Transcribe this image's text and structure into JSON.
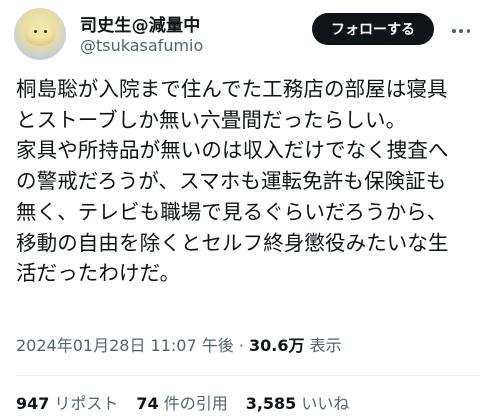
{
  "author": {
    "display_name": "司史生@減量中",
    "handle": "@tsukasafumio",
    "avatar_icon": "yellow-blob-avatar"
  },
  "follow_button": {
    "label": "フォローする"
  },
  "tweet": {
    "lines": [
      "桐島聡が入院まで住んでた工務店の部屋は寝具",
      "とストーブしか無い六畳間だったらしい。",
      "家具や所持品が無いのは収入だけでなく捜査へ",
      "の警戒だろうが、スマホも運転免許も保険証も",
      "無く、テレビも職場で見るぐらいだろうから、",
      "移動の自由を除くとセルフ終身懲役みたいな生",
      "活だったわけだ。"
    ]
  },
  "meta": {
    "timestamp": "2024年01月28日 11:07 午後",
    "separator": " · ",
    "views_count": "30.6万",
    "views_label": "表示"
  },
  "stats": {
    "reposts_count": "947",
    "reposts_label": "リポスト",
    "quotes_count": "74",
    "quotes_label": "件の引用",
    "likes_count": "3,585",
    "likes_label": "いいね"
  },
  "colors": {
    "text_primary": "#0f1419",
    "text_secondary": "#536471",
    "button_bg": "#0f1419",
    "button_text": "#ffffff",
    "divider": "#eff3f4"
  }
}
